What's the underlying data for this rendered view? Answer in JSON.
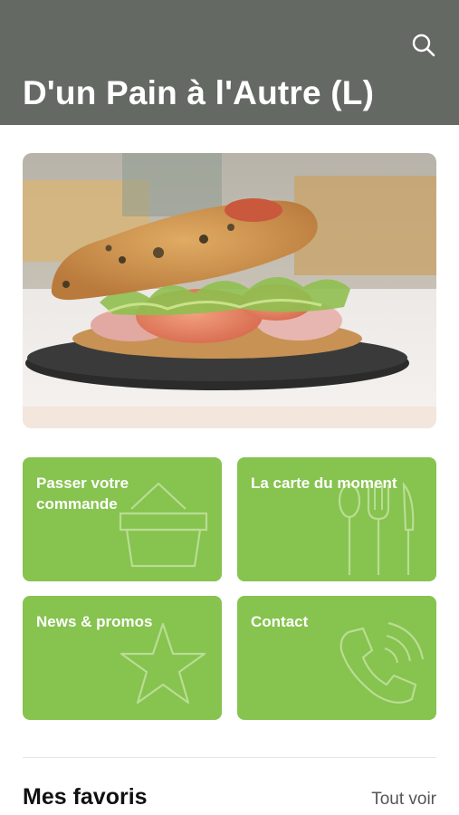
{
  "header": {
    "title": "D'un Pain à l'Autre (L)",
    "search_icon": "search-icon",
    "background": "#646963"
  },
  "hero": {
    "image": "sandwich-photo"
  },
  "tiles": [
    {
      "label": "Passer votre commande",
      "icon": "basket-icon"
    },
    {
      "label": "La carte du moment",
      "icon": "cutlery-icon"
    },
    {
      "label": "News & promos",
      "icon": "star-icon"
    },
    {
      "label": "Contact",
      "icon": "phone-icon"
    }
  ],
  "favorites": {
    "title": "Mes favoris",
    "see_all": "Tout voir"
  },
  "colors": {
    "tile_green": "#86c34f",
    "header_gray": "#646963"
  }
}
